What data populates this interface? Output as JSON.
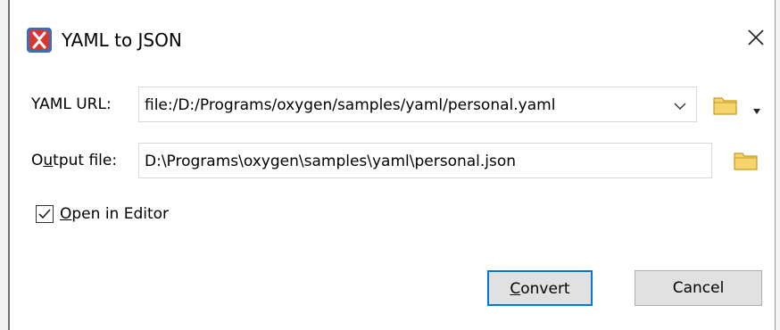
{
  "window": {
    "title": "YAML to JSON",
    "icon": "oxygen-x-icon",
    "close_icon": "close-icon"
  },
  "yaml_url": {
    "label_prefix": "YAML URL:",
    "value": "file:/D:/Programs/oxygen/samples/yaml/personal.yaml",
    "dropdown_icon": "chevron-down-icon",
    "browse_icon": "folder-icon",
    "menu_icon": "caret-down-icon"
  },
  "output_file": {
    "label_pre": "O",
    "label_mnemonic": "u",
    "label_post": "tput file:",
    "value": "D:\\Programs\\oxygen\\samples\\yaml\\personal.json",
    "browse_icon": "folder-icon"
  },
  "open_in_editor": {
    "label_mnemonic": "O",
    "label_rest": "pen in Editor",
    "checked": true
  },
  "buttons": {
    "convert_mnemonic": "C",
    "convert_rest": "onvert",
    "cancel": "Cancel"
  },
  "colors": {
    "accent": "#0078d7",
    "folder": "#e6b833",
    "icon_red": "#d9372b",
    "icon_blue": "#3a6fb5"
  }
}
